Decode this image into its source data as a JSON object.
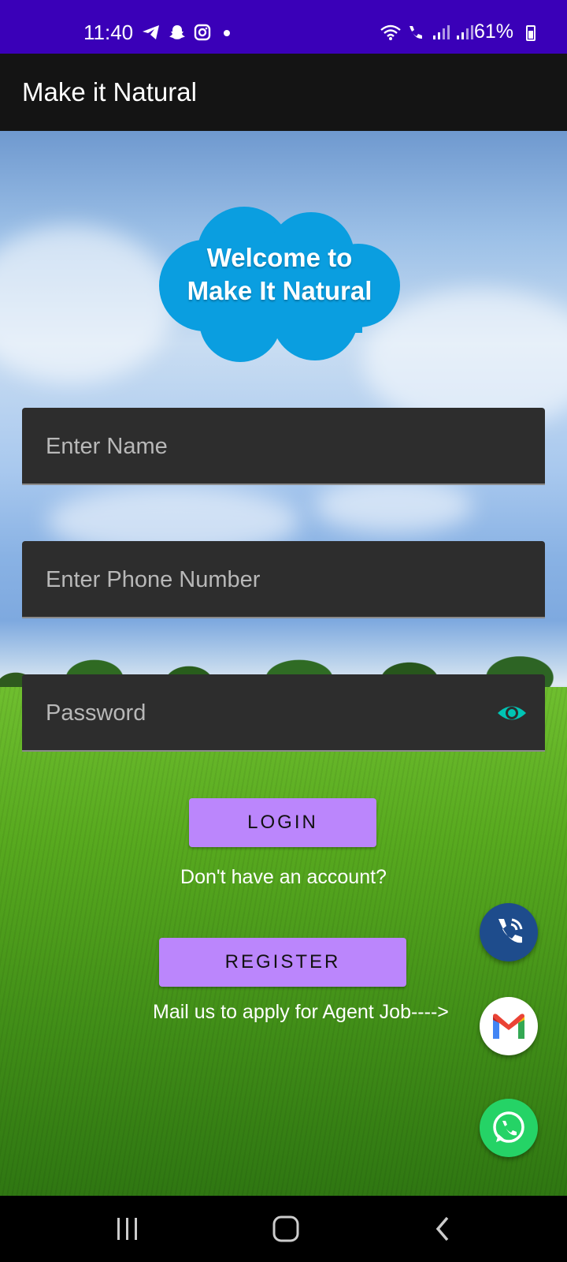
{
  "status_bar": {
    "time": "11:40",
    "battery": "61%",
    "left_icons": [
      "telegram-icon",
      "snapchat-icon",
      "instagram-icon",
      "dot-icon"
    ],
    "right_icons": [
      "wifi-icon",
      "wifi-call-icon",
      "signal-icon",
      "signal-icon"
    ]
  },
  "app_bar": {
    "title": "Make it Natural"
  },
  "welcome": {
    "text_line1": "Welcome to",
    "text_line2": "Make It Natural"
  },
  "form": {
    "name_placeholder": "Enter Name",
    "phone_placeholder": "Enter Phone Number",
    "password_placeholder": "Password",
    "login_label": "LOGIN",
    "no_account_text": "Don't have an account?",
    "register_label": "REGISTER",
    "agent_text": "Mail us to apply for Agent Job---->"
  },
  "colors": {
    "status_bar": "#3a00b8",
    "app_bar": "#141414",
    "button": "#bb86fc",
    "field": "#2d2d2d",
    "eye_icon": "#00c4b4",
    "phone_fab": "#1e4c8c",
    "whatsapp_fab": "#25d366"
  },
  "fabs": [
    "phone-call-icon",
    "gmail-icon",
    "whatsapp-icon"
  ],
  "nav_bar": [
    "recent-apps-icon",
    "home-icon",
    "back-icon"
  ]
}
